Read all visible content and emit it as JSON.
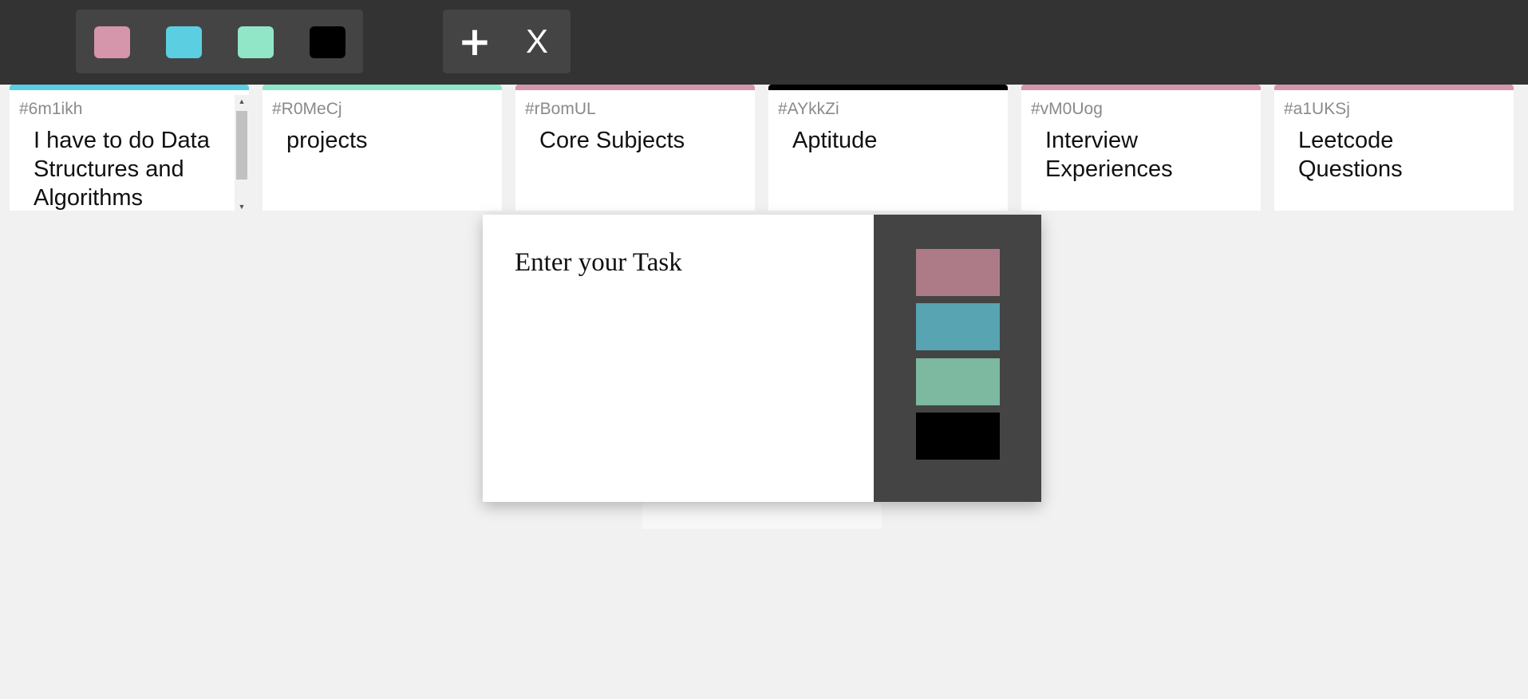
{
  "toolbar": {
    "color_filters": [
      {
        "name": "pink",
        "color": "#d595aa"
      },
      {
        "name": "blue",
        "color": "#5bcfe1"
      },
      {
        "name": "green",
        "color": "#91e6c7"
      },
      {
        "name": "black",
        "color": "#000000"
      }
    ],
    "add_label": "+",
    "remove_label": "X"
  },
  "tickets": [
    {
      "id": "#6m1ikh",
      "task": "I have to do Data Structures and Algorithms",
      "color": "#5bcfe1",
      "scrollable": true
    },
    {
      "id": "#R0MeCj",
      "task": "projects",
      "color": "#91e6c7"
    },
    {
      "id": "#rBomUL",
      "task": "Core Subjects",
      "color": "#d595aa"
    },
    {
      "id": "#AYkkZi",
      "task": "Aptitude",
      "color": "#000000"
    },
    {
      "id": "#vM0Uog",
      "task": "Interview Experiences",
      "color": "#d595aa"
    },
    {
      "id": "#a1UKSj",
      "task": "Leetcode Questions",
      "color": "#d595aa"
    }
  ],
  "modal": {
    "placeholder": "Enter your Task",
    "priority_colors": [
      {
        "name": "pink",
        "color": "#ad7b87"
      },
      {
        "name": "blue",
        "color": "#58a4b3"
      },
      {
        "name": "green",
        "color": "#7db8a0"
      },
      {
        "name": "black",
        "color": "#000000"
      }
    ]
  }
}
